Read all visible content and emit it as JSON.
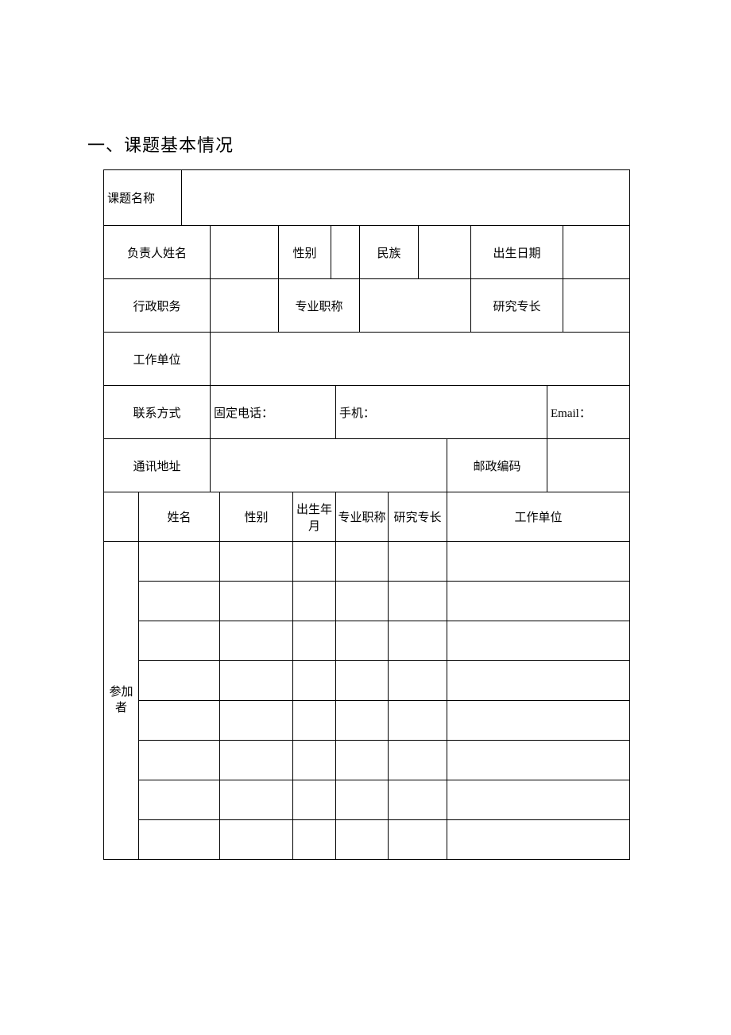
{
  "heading": "一、课题基本情况",
  "labels": {
    "project_name": "课题名称",
    "leader_name": "负责人姓名",
    "gender": "性别",
    "ethnicity": "民族",
    "birth_date": "出生日期",
    "admin_post": "行政职务",
    "prof_title": "专业职称",
    "research_spec": "研究专长",
    "work_unit": "工作单位",
    "contact": "联系方式",
    "landline": "固定电话：",
    "mobile": "手机：",
    "email": "Email：",
    "address": "通讯地址",
    "postcode": "邮政编码",
    "col_name": "姓名",
    "col_gender": "性别",
    "col_birth": "出生年月",
    "col_title": "专业职称",
    "col_spec": "研究专长",
    "col_unit": "工作单位",
    "participants": "参加者"
  },
  "values": {
    "project_name": "",
    "leader_name": "",
    "gender": "",
    "ethnicity": "",
    "birth_date": "",
    "admin_post": "",
    "prof_title": "",
    "research_spec": "",
    "work_unit": "",
    "landline": "",
    "mobile": "",
    "email": "",
    "address": "",
    "postcode": ""
  },
  "participants": [
    {
      "name": "",
      "gender": "",
      "birth": "",
      "title": "",
      "spec": "",
      "unit": ""
    },
    {
      "name": "",
      "gender": "",
      "birth": "",
      "title": "",
      "spec": "",
      "unit": ""
    },
    {
      "name": "",
      "gender": "",
      "birth": "",
      "title": "",
      "spec": "",
      "unit": ""
    },
    {
      "name": "",
      "gender": "",
      "birth": "",
      "title": "",
      "spec": "",
      "unit": ""
    },
    {
      "name": "",
      "gender": "",
      "birth": "",
      "title": "",
      "spec": "",
      "unit": ""
    },
    {
      "name": "",
      "gender": "",
      "birth": "",
      "title": "",
      "spec": "",
      "unit": ""
    },
    {
      "name": "",
      "gender": "",
      "birth": "",
      "title": "",
      "spec": "",
      "unit": ""
    },
    {
      "name": "",
      "gender": "",
      "birth": "",
      "title": "",
      "spec": "",
      "unit": ""
    }
  ]
}
